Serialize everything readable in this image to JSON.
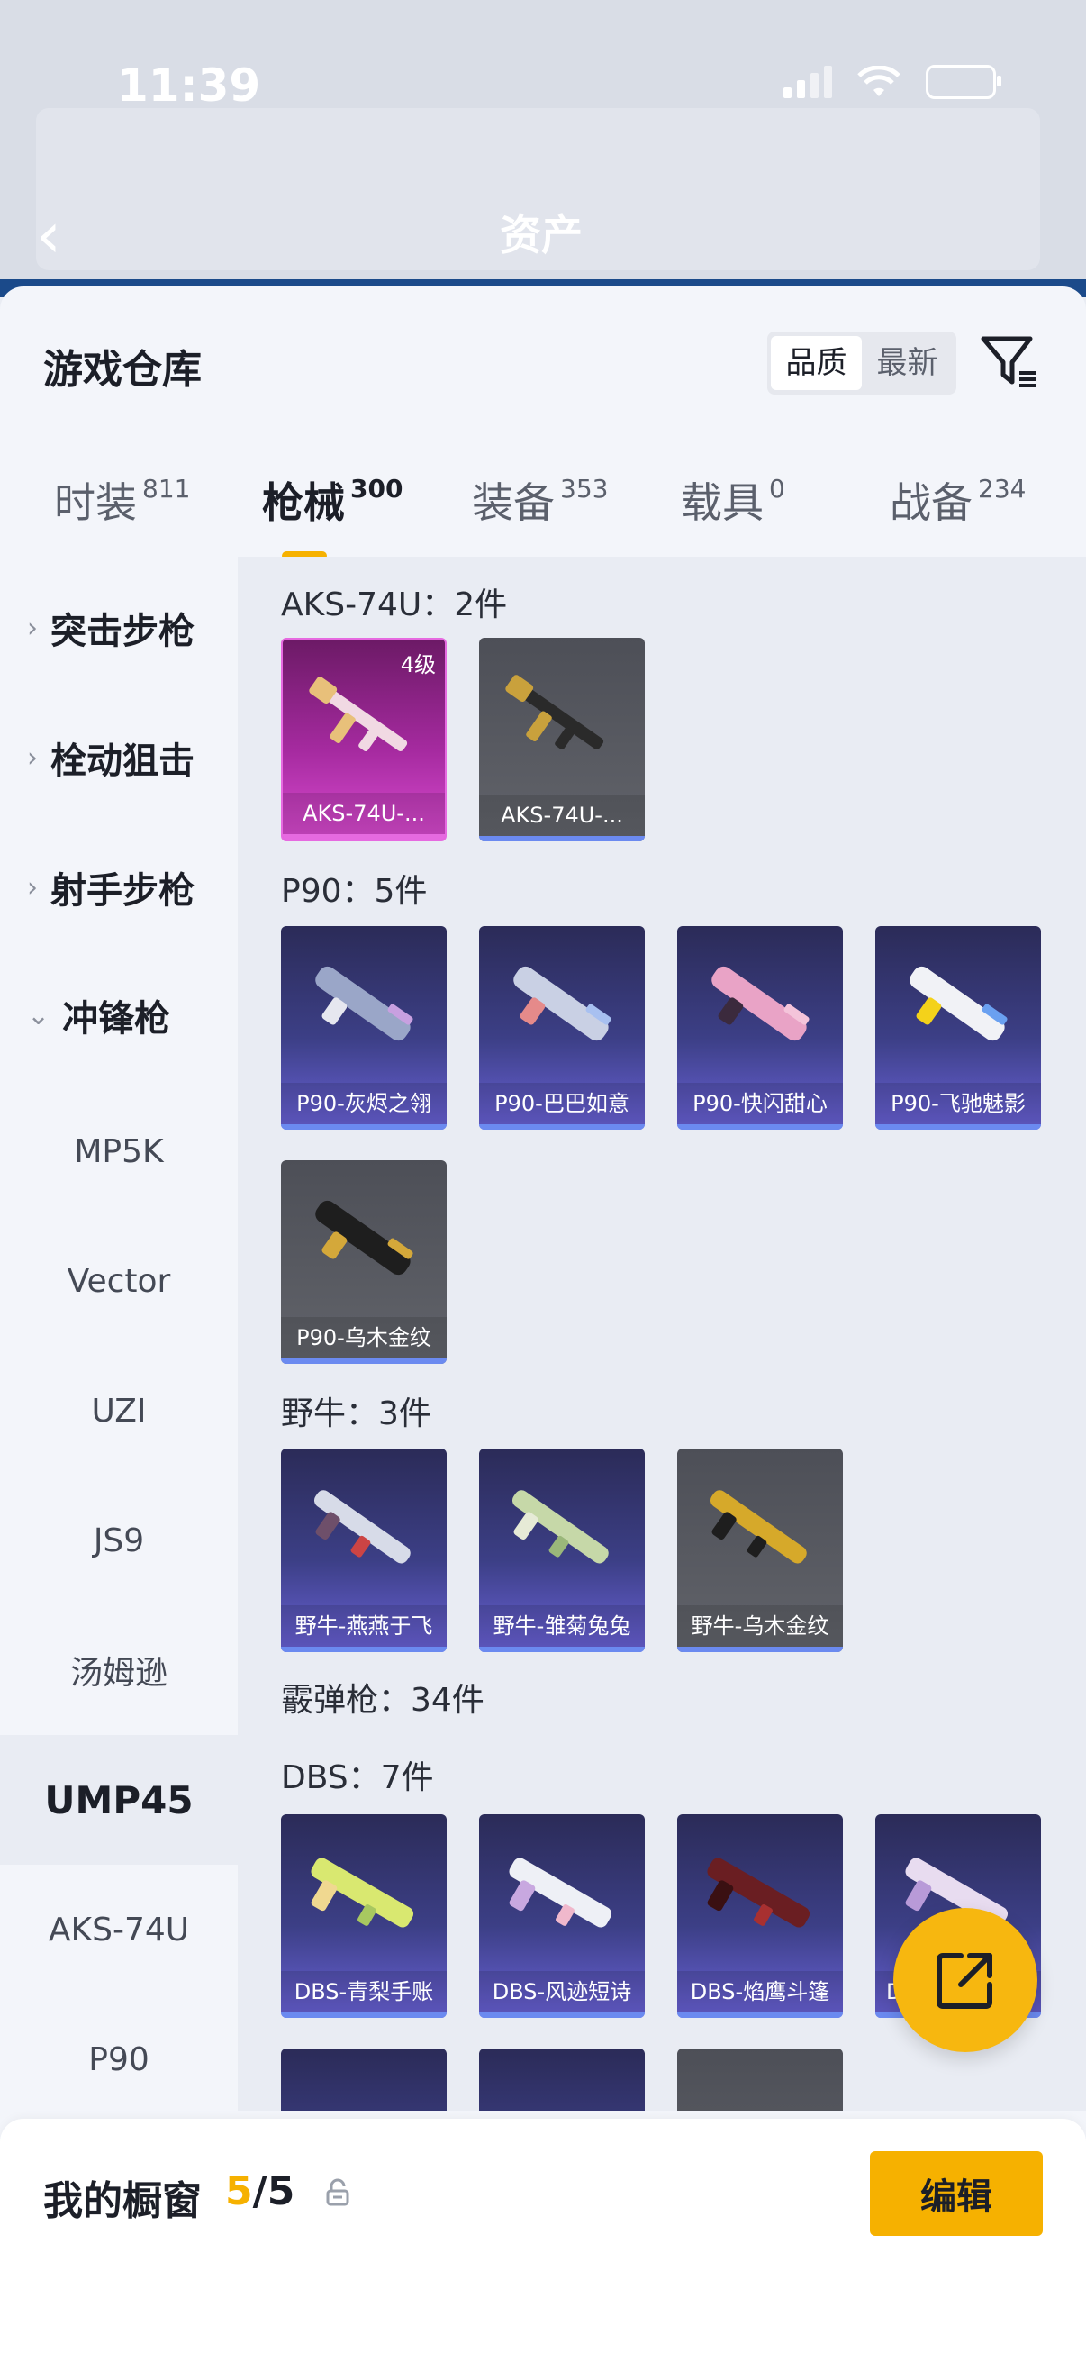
{
  "status": {
    "time": "11:39"
  },
  "header": {
    "title": "资产"
  },
  "sheet": {
    "title": "游戏仓库",
    "sort_options": [
      "品质",
      "最新"
    ],
    "sort_selected": "品质"
  },
  "tabs": [
    {
      "label": "时装",
      "count": "811"
    },
    {
      "label": "枪械",
      "count": "300"
    },
    {
      "label": "装备",
      "count": "353"
    },
    {
      "label": "载具",
      "count": "0"
    },
    {
      "label": "战备",
      "count": "234"
    }
  ],
  "sidebar": {
    "categories": [
      {
        "label": "突击步枪",
        "chevron": "›"
      },
      {
        "label": "栓动狙击",
        "chevron": "›"
      },
      {
        "label": "射手步枪",
        "chevron": "›"
      },
      {
        "label": "冲锋枪",
        "chevron": "⌄"
      }
    ],
    "items": [
      "MP5K",
      "Vector",
      "UZI",
      "JS9",
      "汤姆逊",
      "UMP45",
      "AKS-74U",
      "P90"
    ],
    "selected": "UMP45"
  },
  "groups": {
    "aks": {
      "label": "AKS-74U：2件",
      "items": [
        {
          "name": "AKS-74U-...",
          "level": "4级",
          "rarity": "pink"
        },
        {
          "name": "AKS-74U-...",
          "rarity": "gray"
        }
      ]
    },
    "p90": {
      "label": "P90：5件",
      "items": [
        {
          "name": "P90-灰烬之翎",
          "rarity": "purple"
        },
        {
          "name": "P90-巴巴如意",
          "rarity": "purple"
        },
        {
          "name": "P90-快闪甜心",
          "rarity": "purple"
        },
        {
          "name": "P90-飞驰魅影",
          "rarity": "purple"
        },
        {
          "name": "P90-乌木金纹",
          "rarity": "gray"
        }
      ]
    },
    "yeniu": {
      "label": "野牛：3件",
      "items": [
        {
          "name": "野牛-燕燕于飞",
          "rarity": "purple"
        },
        {
          "name": "野牛-雏菊兔兔",
          "rarity": "purple"
        },
        {
          "name": "野牛-乌木金纹",
          "rarity": "gray"
        }
      ]
    },
    "shotgun": {
      "label": "霰弹枪：34件"
    },
    "dbs": {
      "label": "DBS：7件",
      "items": [
        {
          "name": "DBS-青梨手账",
          "rarity": "purple"
        },
        {
          "name": "DBS-风迹短诗",
          "rarity": "purple"
        },
        {
          "name": "DBS-焰鹰斗篷",
          "rarity": "purple"
        },
        {
          "name": "D",
          "rarity": "purple"
        }
      ]
    }
  },
  "showcase": {
    "title": "我的橱窗",
    "count_current": "5",
    "count_sep": "/",
    "count_total": "5",
    "edit_label": "编辑"
  },
  "colors": {
    "accent": "#f6b100",
    "purple_card": "#3c3f86",
    "gray_card": "#5b5d64",
    "pink_card": "#a52a9f"
  }
}
